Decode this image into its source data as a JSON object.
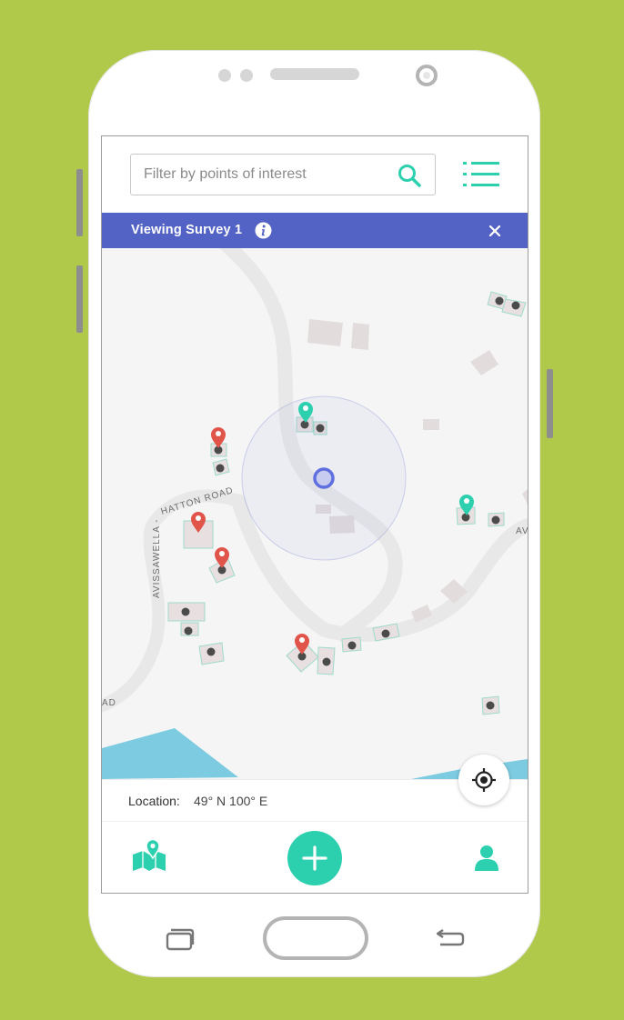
{
  "search": {
    "placeholder": "Filter by points of interest"
  },
  "banner": {
    "title": "Viewing Survey 1"
  },
  "map": {
    "road_labels": [
      "HATTON ROAD",
      "AVISSAWELLA -",
      "AD",
      "AV"
    ]
  },
  "location": {
    "label": "Location:",
    "value": "49° N 100° E"
  },
  "icons": {
    "search": "search-icon",
    "menu": "list-menu-icon",
    "info": "info-icon",
    "close": "close-icon",
    "locate": "crosshair-icon",
    "map_nav": "map-pin-icon",
    "add": "plus-icon",
    "user": "user-icon"
  },
  "colors": {
    "accent": "#2cd0af",
    "banner": "#5262c5",
    "pin_red": "#e0544a",
    "pin_teal": "#2cd0af",
    "water": "#7ccbe0",
    "background": "#b0c94b"
  }
}
